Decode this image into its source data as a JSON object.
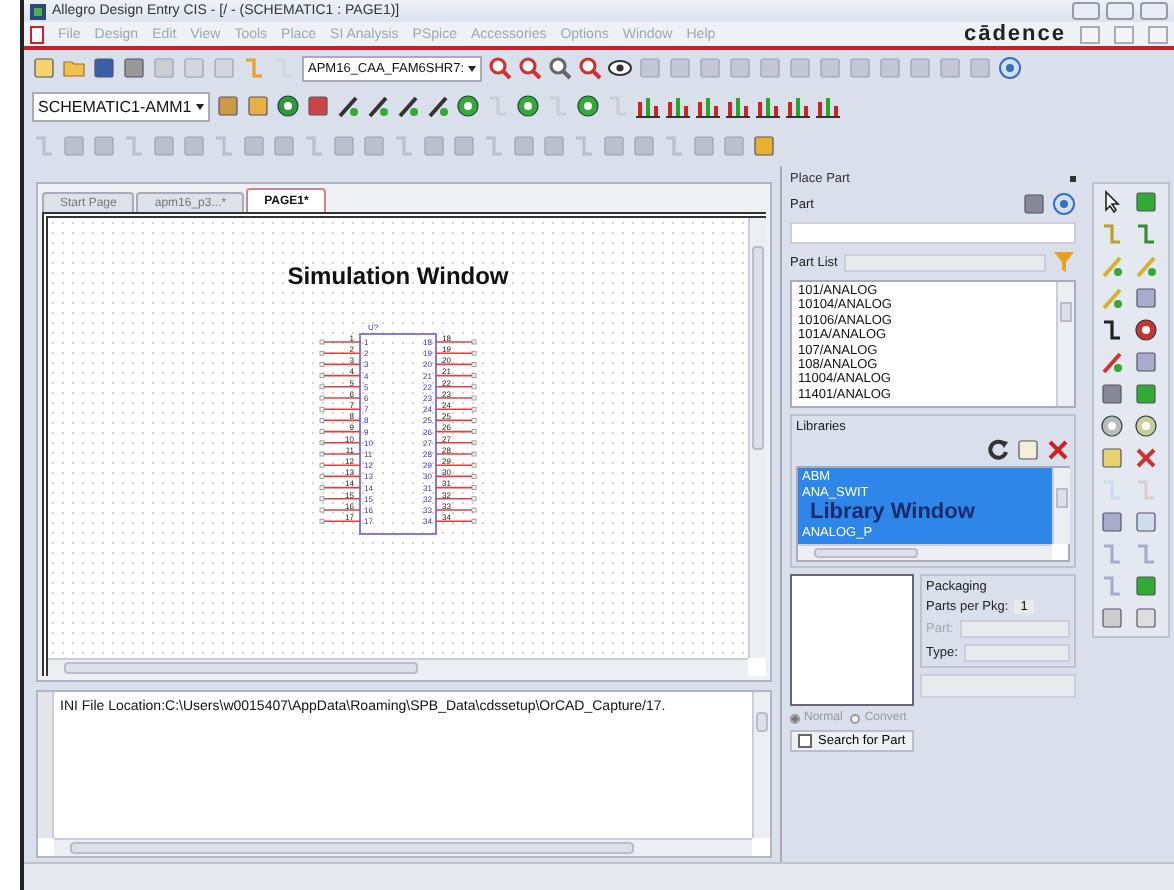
{
  "window": {
    "title": "Allegro Design Entry CIS - [/ - (SCHEMATIC1 : PAGE1)]"
  },
  "menu": [
    {
      "label": "File",
      "disabled": true
    },
    {
      "label": "Design",
      "disabled": true
    },
    {
      "label": "Edit",
      "disabled": true
    },
    {
      "label": "View",
      "disabled": true
    },
    {
      "label": "Tools",
      "disabled": true
    },
    {
      "label": "Place",
      "disabled": true
    },
    {
      "label": "SI Analysis",
      "disabled": true
    },
    {
      "label": "PSpice",
      "disabled": true
    },
    {
      "label": "Accessories",
      "disabled": true
    },
    {
      "label": "Options",
      "disabled": true
    },
    {
      "label": "Window",
      "disabled": true
    },
    {
      "label": "Help",
      "disabled": true
    }
  ],
  "brand": "cādence",
  "toolbar": {
    "part_combo": "APM16_CAA_FAM6SHR7:",
    "design_combo": "SCHEMATIC1-AMM1"
  },
  "tabs": [
    {
      "label": "Start Page",
      "selected": false
    },
    {
      "label": "apm16_p3...*",
      "selected": false
    },
    {
      "label": "PAGE1*",
      "selected": true
    }
  ],
  "schematic": {
    "annotation": "Simulation Window",
    "part_ref": "U?",
    "left_pins": [
      {
        "number": "1",
        "name": "1"
      },
      {
        "number": "2",
        "name": "2"
      },
      {
        "number": "3",
        "name": "3"
      },
      {
        "number": "4",
        "name": "4"
      },
      {
        "number": "5",
        "name": "5"
      },
      {
        "number": "6",
        "name": "6"
      },
      {
        "number": "7",
        "name": "7"
      },
      {
        "number": "8",
        "name": "8"
      },
      {
        "number": "9",
        "name": "9"
      },
      {
        "number": "10",
        "name": "10"
      },
      {
        "number": "11",
        "name": "11"
      },
      {
        "number": "12",
        "name": "12"
      },
      {
        "number": "13",
        "name": "13"
      },
      {
        "number": "14",
        "name": "14"
      },
      {
        "number": "15",
        "name": "15"
      },
      {
        "number": "16",
        "name": "16"
      },
      {
        "number": "17",
        "name": "17"
      }
    ],
    "right_pins": [
      {
        "number": "18",
        "name": "18"
      },
      {
        "number": "19",
        "name": "19"
      },
      {
        "number": "20",
        "name": "20"
      },
      {
        "number": "21",
        "name": "21"
      },
      {
        "number": "22",
        "name": "22"
      },
      {
        "number": "23",
        "name": "23"
      },
      {
        "number": "24",
        "name": "24"
      },
      {
        "number": "25",
        "name": "25"
      },
      {
        "number": "26",
        "name": "26"
      },
      {
        "number": "27",
        "name": "27"
      },
      {
        "number": "28",
        "name": "28"
      },
      {
        "number": "29",
        "name": "29"
      },
      {
        "number": "30",
        "name": "30"
      },
      {
        "number": "31",
        "name": "31"
      },
      {
        "number": "32",
        "name": "32"
      },
      {
        "number": "33",
        "name": "33"
      },
      {
        "number": "34",
        "name": "34"
      }
    ]
  },
  "session_log": "INI File Location:C:\\Users\\w0015407\\AppData\\Roaming\\SPB_Data\\cdssetup\\OrCAD_Capture/17.",
  "place_part": {
    "title": "Place Part",
    "part_label": "Part",
    "part_list_label": "Part List",
    "parts": [
      "101/ANALOG",
      "10104/ANALOG",
      "10106/ANALOG",
      "101A/ANALOG",
      "107/ANALOG",
      "108/ANALOG",
      "11004/ANALOG",
      "11401/ANALOG"
    ],
    "libraries_label": "Libraries",
    "libraries": [
      {
        "name": "ABM",
        "selected": true
      },
      {
        "name": "ANA_SWIT",
        "selected": true
      },
      {
        "name": "ANALOG_P",
        "selected": true
      }
    ],
    "library_annotation": "Library Window",
    "packaging": {
      "title": "Packaging",
      "parts_per_pkg_label": "Parts per Pkg:",
      "parts_per_pkg": "1",
      "part_label": "Part:",
      "type_label": "Type:"
    },
    "radios": [
      {
        "label": "Normal",
        "selected": true
      },
      {
        "label": "Convert",
        "selected": false
      }
    ],
    "search_label": "Search for Part"
  }
}
